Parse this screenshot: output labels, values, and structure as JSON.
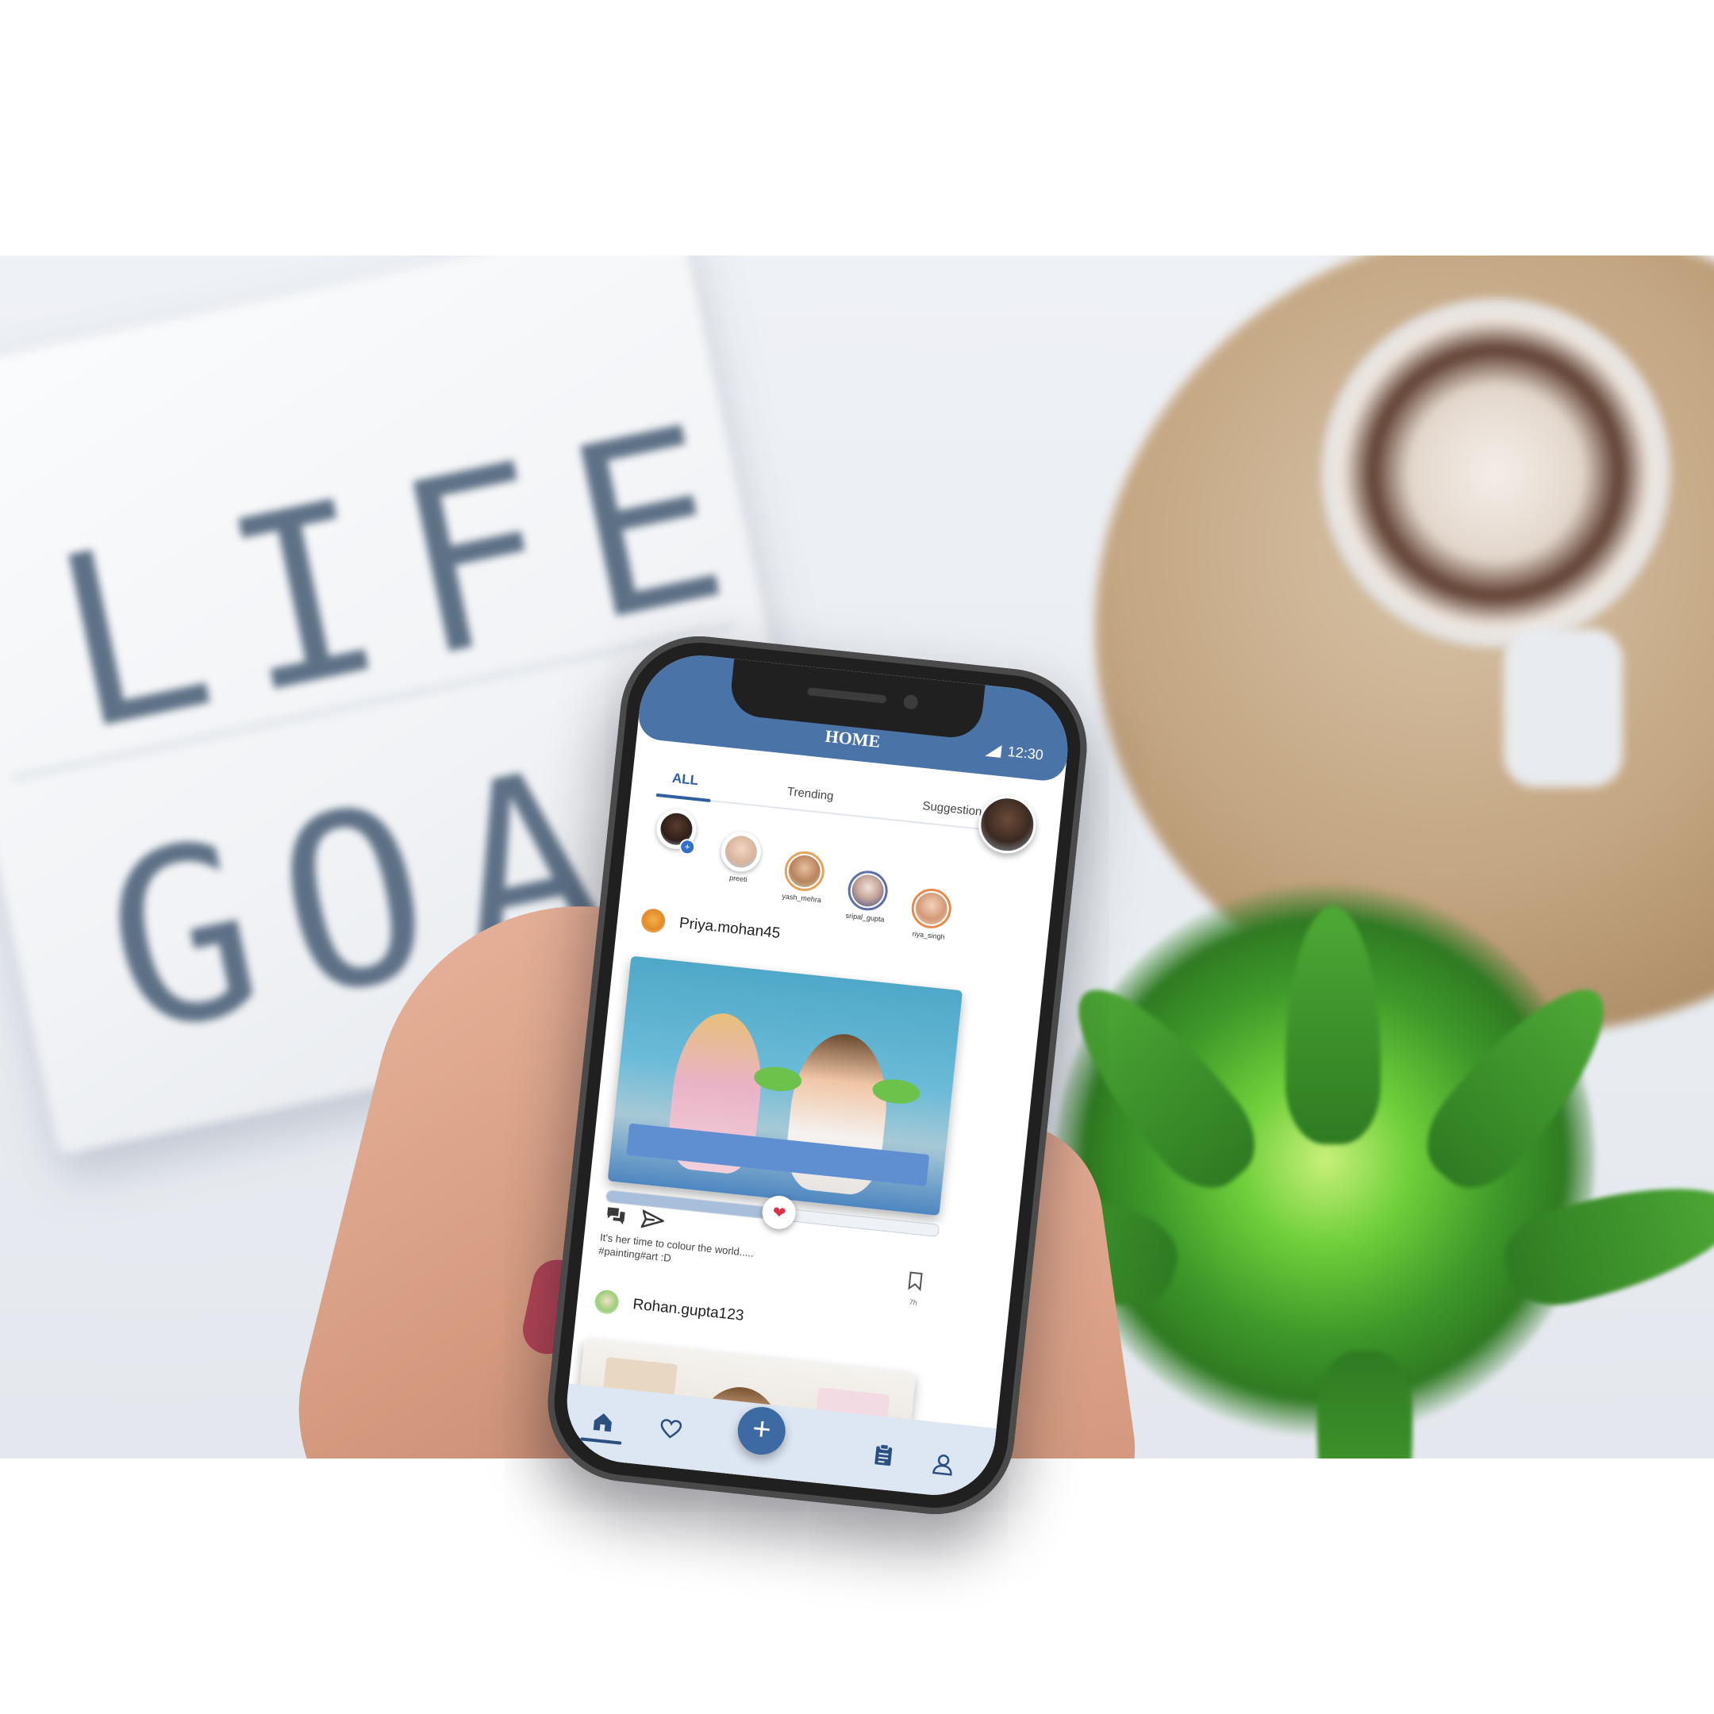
{
  "app": {
    "header_title": "HOME",
    "status_time": "12:30"
  },
  "tabs": [
    {
      "label": "ALL",
      "active": true
    },
    {
      "label": "Trending",
      "active": false
    },
    {
      "label": "Suggestions",
      "active": false
    }
  ],
  "stories": [
    {
      "name": "",
      "is_self": true,
      "add_badge": "+"
    },
    {
      "name": "preeti"
    },
    {
      "name": "yash_mehra"
    },
    {
      "name": "sripal_gupta"
    },
    {
      "name": "riya_singh"
    }
  ],
  "posts": [
    {
      "username": "Priya.mohan45",
      "caption": "It's her time to colour the world.....",
      "hashtags": "#painting#art :D",
      "time": "7h",
      "like_slider_fraction": 0.52
    },
    {
      "username": "Rohan.gupta123"
    }
  ],
  "bottom_nav": {
    "add_button_glyph": "+"
  },
  "colors": {
    "primary": "#4a73a8",
    "nav_background": "#dde6f3",
    "like_heart": "#d8344a"
  },
  "icons": {
    "home": "home-icon",
    "favorites": "heart-icon",
    "add": "plus-icon",
    "tasks": "clipboard-icon",
    "profile": "user-icon",
    "comment": "chat-bubbles-icon",
    "share": "send-icon",
    "save": "bookmark-icon"
  }
}
